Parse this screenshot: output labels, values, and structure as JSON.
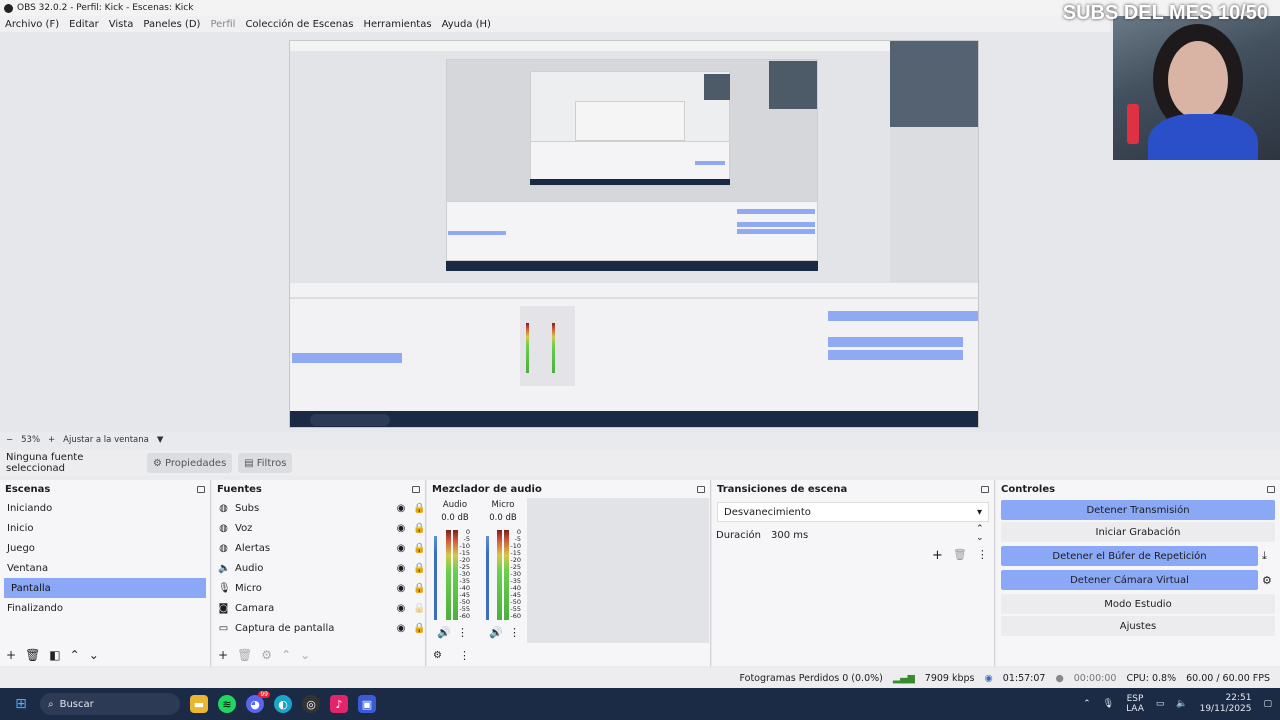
{
  "window": {
    "title": "OBS 32.0.2 - Perfil: Kick - Escenas: Kick"
  },
  "menu": [
    "Archivo (F)",
    "Editar",
    "Vista",
    "Paneles (D)",
    "Perfil",
    "Colección de Escenas",
    "Herramientas",
    "Ayuda (H)"
  ],
  "overlay": {
    "subs_text": "SUBS DEL MES 10/50"
  },
  "zoom": {
    "minus": "−",
    "value": "53%",
    "plus": "+",
    "fit_label": "Ajustar a la ventana"
  },
  "source_toolbar": {
    "status": "Ninguna fuente seleccionad",
    "properties": "Propiedades",
    "filters": "Filtros"
  },
  "scenes": {
    "title": "Escenas",
    "items": [
      "Iniciando",
      "Inicio",
      "Juego",
      "Ventana",
      "Pantalla",
      "Finalizando"
    ],
    "selected": "Pantalla"
  },
  "sources": {
    "title": "Fuentes",
    "items": [
      {
        "name": "Subs",
        "icon": "globe-icon",
        "visible": true,
        "locked": true
      },
      {
        "name": "Voz",
        "icon": "globe-icon",
        "visible": true,
        "locked": true
      },
      {
        "name": "Alertas",
        "icon": "globe-icon",
        "visible": true,
        "locked": true
      },
      {
        "name": "Audio",
        "icon": "speaker-icon",
        "visible": true,
        "locked": true
      },
      {
        "name": "Micro",
        "icon": "microphone-icon",
        "visible": true,
        "locked": true
      },
      {
        "name": "Camara",
        "icon": "camera-icon",
        "visible": true,
        "locked": false
      },
      {
        "name": "Captura de pantalla",
        "icon": "monitor-icon",
        "visible": true,
        "locked": true
      }
    ]
  },
  "mixer": {
    "title": "Mezclador de audio",
    "channels": [
      {
        "name": "Audio",
        "db": "0.0 dB"
      },
      {
        "name": "Micro",
        "db": "0.0 dB"
      }
    ],
    "scale": [
      "0",
      "-5",
      "-10",
      "-15",
      "-20",
      "-25",
      "-30",
      "-35",
      "-40",
      "-45",
      "-50",
      "-55",
      "-60"
    ]
  },
  "transitions": {
    "title": "Transiciones de escena",
    "selected": "Desvanecimiento",
    "duration_label": "Duración",
    "duration_value": "300 ms"
  },
  "controls": {
    "title": "Controles",
    "buttons": [
      {
        "label": "Detener Transmisión",
        "active": true
      },
      {
        "label": "Iniciar Grabación",
        "active": false
      },
      {
        "label": "Detener el Búfer de Repetición",
        "active": true
      },
      {
        "label": "Detener Cámara Virtual",
        "active": true
      },
      {
        "label": "Modo Estudio",
        "active": false
      },
      {
        "label": "Ajustes",
        "active": false
      }
    ]
  },
  "status": {
    "dropped": "Fotogramas Perdidos 0 (0.0%)",
    "bitrate": "7909 kbps",
    "stream_time": "01:57:07",
    "rec_time": "00:00:00",
    "cpu": "CPU: 0.8%",
    "fps": "60.00 / 60.00 FPS"
  },
  "taskbar": {
    "search": "Buscar",
    "lang1": "ESP",
    "lang2": "LAA",
    "time": "22:51",
    "date": "19/11/2025",
    "discord_badge": "99"
  },
  "colors": {
    "accent": "#8aa8f5",
    "taskbar": "#1c2b45"
  }
}
